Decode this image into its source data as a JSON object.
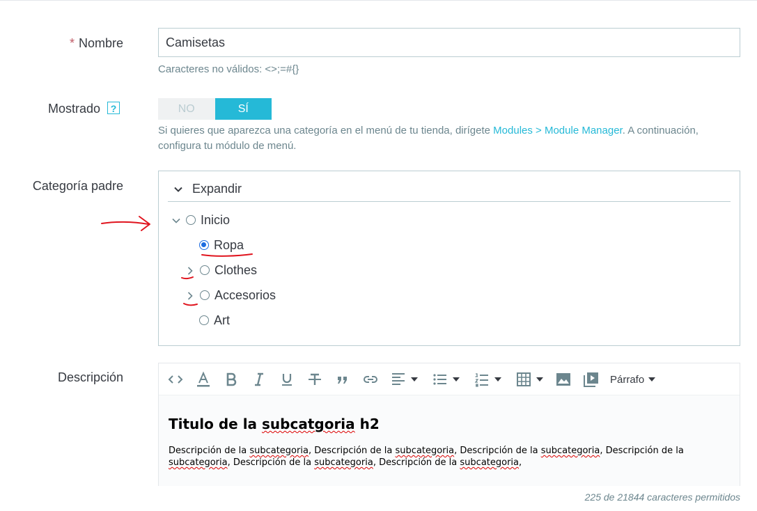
{
  "fields": {
    "name": {
      "required_mark": "*",
      "label": "Nombre",
      "value": "Camisetas",
      "hint": "Caracteres no válidos: <>;=#{}"
    },
    "displayed": {
      "label": "Mostrado",
      "help_icon": "?",
      "off_label": "NO",
      "on_label": "SÍ",
      "selected": "SÍ",
      "hint_before": "Si quieres que aparezca una categoría en el menú de tu tienda, dirígete ",
      "hint_link": "Modules > Module Manager",
      "hint_after": ". A continuación,",
      "hint_line2": "configura tu módulo de menú."
    },
    "parent_category": {
      "label": "Categoría padre",
      "expand_label": "Expandir",
      "tree": [
        {
          "label": "Inicio",
          "selected": false
        },
        {
          "label": "Ropa",
          "selected": true
        },
        {
          "label": "Clothes",
          "selected": false
        },
        {
          "label": "Accesorios",
          "selected": false
        },
        {
          "label": "Art",
          "selected": false
        }
      ]
    },
    "description": {
      "label": "Descripción",
      "format_label": "Párrafo",
      "heading_a": "Titulo de la ",
      "heading_b": "subcatgoria",
      "heading_c": " h2",
      "body_line1_seg1": "Descripción de la ",
      "body_line1_seg2": "subcategoria",
      "body_line1_seg3": ",  Descripción de la ",
      "body_line1_seg4": "subcategoria",
      "body_line1_seg5": ",  Descripción de la ",
      "body_line1_seg6": "subcategoria",
      "body_line1_seg7": ",  Descripción de la",
      "body_line2_seg1": "subcategoria",
      "body_line2_seg2": ",  Descripción de la ",
      "body_line2_seg3": "subcategoria",
      "body_line2_seg4": ",  Descripción de la ",
      "body_line2_seg5": "subcategoria",
      "body_line2_seg6": ",",
      "counter": "225 de 21844 caracteres permitidos"
    }
  },
  "colors": {
    "accent": "#25b9d7",
    "required": "#c05c67",
    "radio_selected": "#1d6ce0",
    "annotation": "#e0141e"
  },
  "toolbar_icons": [
    "code-icon",
    "text-color-icon",
    "bold-icon",
    "italic-icon",
    "underline-icon",
    "strikethrough-icon",
    "blockquote-icon",
    "link-icon",
    "align-icon",
    "bullet-list-icon",
    "numbered-list-icon",
    "table-icon",
    "image-icon",
    "media-icon"
  ]
}
